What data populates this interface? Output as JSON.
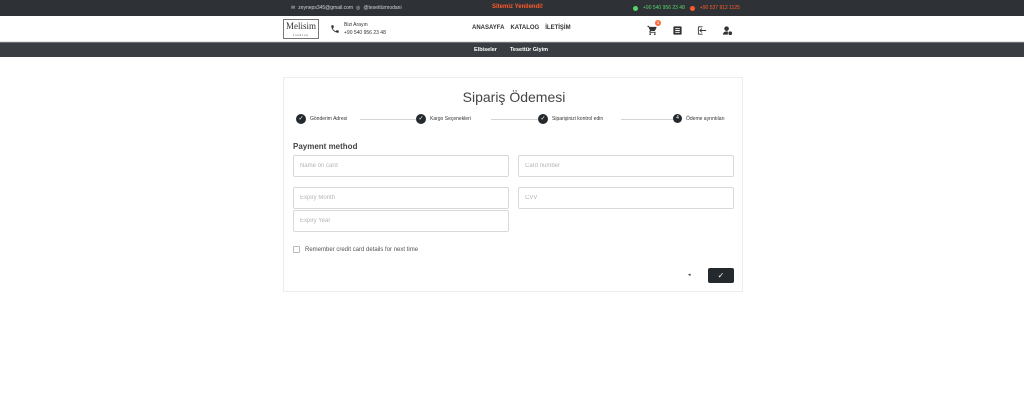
{
  "topbar": {
    "email": "zeyneps345@gmail.com",
    "social": "@tesettürmodani",
    "announcement": "Sitemiz Yenilendi!",
    "whatsapp": "+90 540 956 23 48",
    "phone": "+90 537 912 1125"
  },
  "header": {
    "logo_text": "Melisim",
    "logo_sub": "fashion",
    "call_label": "Bizi Arayın",
    "call_number": "+90 540 956 23 48",
    "nav": [
      "ANASAYFA",
      "KATALOG",
      "İLETİŞİM"
    ],
    "cart_count": "1"
  },
  "categories": [
    "Elbiseler",
    "Tesettür Giyim"
  ],
  "checkout": {
    "title": "Sipariş Ödemesi",
    "steps": [
      {
        "label": "Gönderim Adresi",
        "state": "done"
      },
      {
        "label": "Kargo Seçenekleri",
        "state": "done"
      },
      {
        "label": "Siparişinizi kontrol edin",
        "state": "done"
      },
      {
        "label": "Ödeme ayrıntıları",
        "state": "active",
        "number": "4"
      }
    ],
    "payment_heading": "Payment method",
    "fields": {
      "name_on_card": "Name on card",
      "card_number": "Card number",
      "expiry_month": "Expiry Month",
      "cvv": "CVV",
      "expiry_year": "Expiry Year"
    },
    "remember_label": "Remember credit card details for next time",
    "back_symbol": "◂",
    "submit_symbol": "✓"
  },
  "colors": {
    "dark": "#24292e",
    "accent": "#ff5a2a",
    "whatsapp": "#58d46a"
  }
}
